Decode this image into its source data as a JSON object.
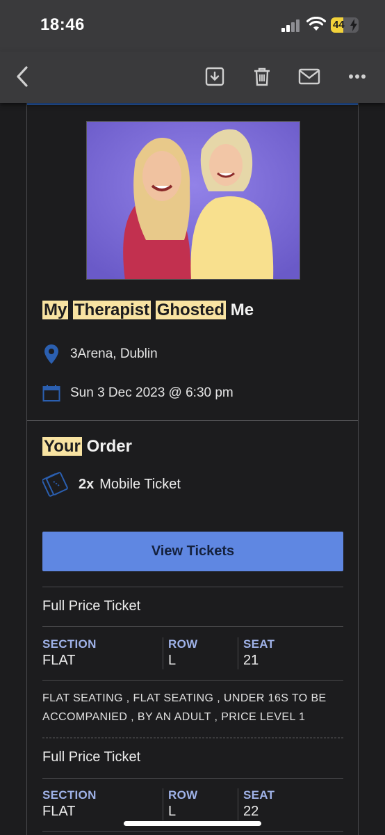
{
  "status_bar": {
    "time": "18:46",
    "battery": "44",
    "battery_level": 0.44,
    "battery_color": "#f2d23a"
  },
  "toolbar": {
    "back": "back-icon",
    "actions": [
      "archive-icon",
      "trash-icon",
      "mail-icon",
      "more-icon"
    ]
  },
  "event": {
    "title_words": [
      "My",
      "Therapist",
      "Ghosted",
      "Me"
    ],
    "venue": "3Arena, Dublin",
    "datetime": "Sun 3 Dec 2023 @ 6:30 pm"
  },
  "order": {
    "title_words": [
      "Your",
      "Order"
    ],
    "quantity": "2x",
    "ticket_kind": "Mobile Ticket",
    "button_label": "View Tickets"
  },
  "tickets": [
    {
      "type": "Full Price Ticket",
      "section_label": "SECTION",
      "section": "FLAT",
      "row_label": "ROW",
      "row": "L",
      "seat_label": "SEAT",
      "seat": "21",
      "notes": "FLAT SEATING , FLAT SEATING , UNDER 16S TO BE ACCOMPANIED , BY AN ADULT , PRICE LEVEL 1"
    },
    {
      "type": "Full Price Ticket",
      "section_label": "SECTION",
      "section": "FLAT",
      "row_label": "ROW",
      "row": "L",
      "seat_label": "SEAT",
      "seat": "22"
    }
  ],
  "colors": {
    "accent": "#5f87e2",
    "highlight": "#f8e3a2",
    "icon_blue": "#2b5fb0",
    "label_blue": "#9fb2e8"
  }
}
